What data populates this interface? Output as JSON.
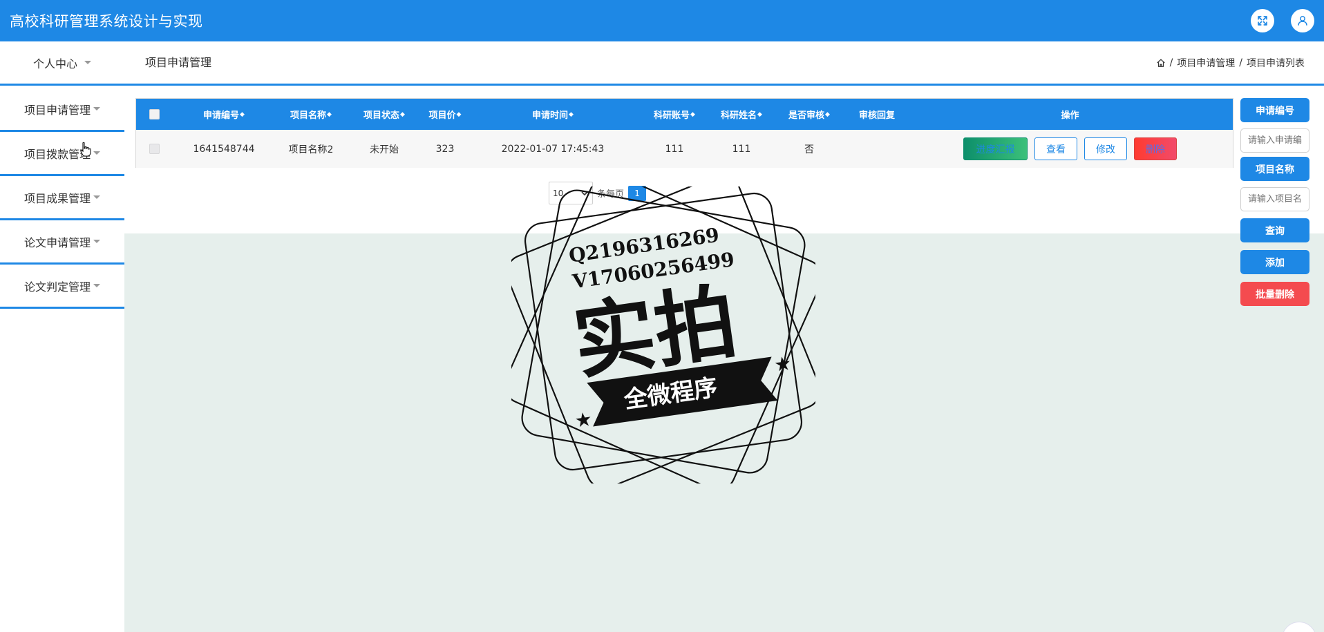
{
  "app": {
    "title": "高校科研管理系统设计与实现"
  },
  "topbar": {
    "fullscreen_icon": "fullscreen-icon",
    "user_icon": "user-icon"
  },
  "subbar": {
    "personal_center": "个人中心",
    "page_title": "项目申请管理",
    "breadcrumb": [
      "项目申请管理",
      "项目申请列表"
    ]
  },
  "sidebar": {
    "items": [
      {
        "label": "项目申请管理"
      },
      {
        "label": "项目拨款管理"
      },
      {
        "label": "项目成果管理"
      },
      {
        "label": "论文申请管理"
      },
      {
        "label": "论文判定管理"
      }
    ]
  },
  "table": {
    "headers": [
      "申请编号",
      "项目名称",
      "项目状态",
      "项目价",
      "申请时间",
      "科研账号",
      "科研姓名",
      "是否审核",
      "审核回复",
      "操作"
    ],
    "rows": [
      {
        "id": "1641548744",
        "name": "项目名称2",
        "status": "未开始",
        "price": "323",
        "time": "2022-01-07 17:45:43",
        "account": "111",
        "researcher": "111",
        "audited": "否",
        "reply": ""
      }
    ],
    "actions": {
      "progress": "进度汇报",
      "view": "查看",
      "edit": "修改",
      "delete": "删除"
    }
  },
  "pagination": {
    "page_size": "10",
    "per_page_label": "条每页",
    "current_page": "1"
  },
  "search": {
    "id_label": "申请编号",
    "id_placeholder": "请输入申请编号",
    "name_label": "项目名称",
    "name_placeholder": "请输入项目名称",
    "query_button": "查询",
    "add_button": "添加",
    "batch_delete_button": "批量删除"
  },
  "watermark": {
    "line1": "Q2196316269",
    "line2": "V17060256499",
    "main": "实拍",
    "banner": "全微程序"
  },
  "colors": {
    "primary": "#1e88e5",
    "danger": "#f44b4f",
    "content_bg": "#e6efec"
  }
}
